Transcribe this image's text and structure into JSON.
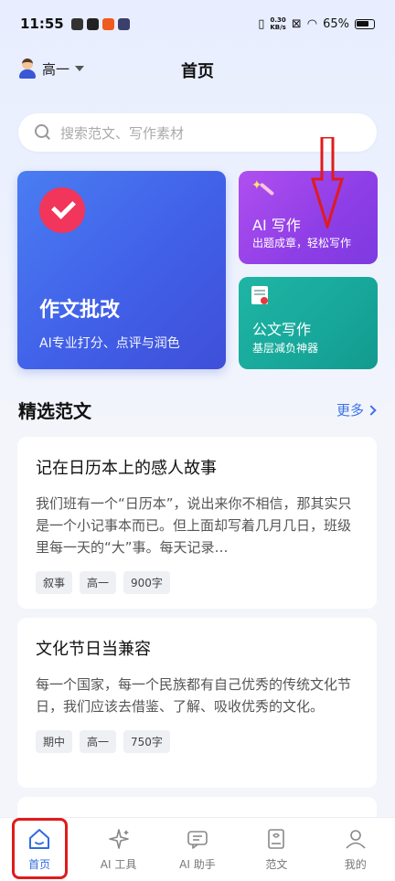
{
  "status_bar": {
    "time": "11:55",
    "net_speed_top": "0.30",
    "net_speed_bottom": "KB/s",
    "battery": "65%"
  },
  "header": {
    "grade": "高一",
    "title": "首页"
  },
  "search": {
    "placeholder": "搜索范文、写作素材"
  },
  "features": {
    "correction": {
      "title": "作文批改",
      "subtitle": "AI专业打分、点评与润色"
    },
    "ai_writing": {
      "title": "AI 写作",
      "subtitle": "出题成章，轻松写作"
    },
    "official_writing": {
      "title": "公文写作",
      "subtitle": "基层减负神器"
    }
  },
  "section": {
    "title": "精选范文",
    "more": "更多"
  },
  "essays": [
    {
      "title": "记在日历本上的感人故事",
      "excerpt": "我们班有一个“日历本”，说出来你不相信，那其实只是一个小记事本而已。但上面却写着几月几日，班级里每一天的“大”事。每天记录…",
      "tags": [
        "叙事",
        "高一",
        "900字"
      ]
    },
    {
      "title": "文化节日当兼容",
      "excerpt": "每一个国家，每一个民族都有自己优秀的传统文化节日，我们应该去借鉴、了解、吸收优秀的文化。",
      "tags": [
        "期中",
        "高一",
        "750字"
      ]
    }
  ],
  "tab_bar": {
    "items": [
      {
        "label": "首页",
        "icon": "home-icon",
        "active": true
      },
      {
        "label": "AI 工具",
        "icon": "sparkle-icon",
        "active": false
      },
      {
        "label": "AI 助手",
        "icon": "chat-icon",
        "active": false
      },
      {
        "label": "范文",
        "icon": "book-icon",
        "active": false
      },
      {
        "label": "我的",
        "icon": "user-icon",
        "active": false
      }
    ]
  },
  "colors": {
    "accent": "#2f6be0",
    "correction_card": "#4160e8",
    "ai_card": "#8e3ee6",
    "official_card": "#17a79a",
    "annotation": "#e01b1b"
  }
}
